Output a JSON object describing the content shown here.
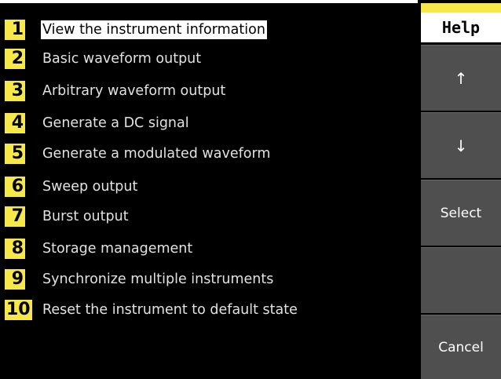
{
  "help_list": {
    "items": [
      {
        "number": "1",
        "label": "View the instrument information"
      },
      {
        "number": "2",
        "label": "Basic waveform output"
      },
      {
        "number": "3",
        "label": "Arbitrary waveform output"
      },
      {
        "number": "4",
        "label": "Generate a DC signal"
      },
      {
        "number": "5",
        "label": "Generate a modulated waveform"
      },
      {
        "number": "6",
        "label": "Sweep output"
      },
      {
        "number": "7",
        "label": "Burst output"
      },
      {
        "number": "8",
        "label": "Storage management"
      },
      {
        "number": "9",
        "label": "Synchronize multiple instruments"
      },
      {
        "number": "10",
        "label": "Reset the instrument to default state"
      }
    ],
    "selected_number": "1"
  },
  "softkeys": {
    "title": "Help",
    "up_label": "↑",
    "down_label": "↓",
    "select_label": "Select",
    "blank_label": "",
    "cancel_label": "Cancel"
  },
  "colors": {
    "number_badge": "#f6e84a",
    "softkey_bg": "#4f4f4f",
    "selection_bg": "#ffffff",
    "screen_bg": "#000000"
  }
}
